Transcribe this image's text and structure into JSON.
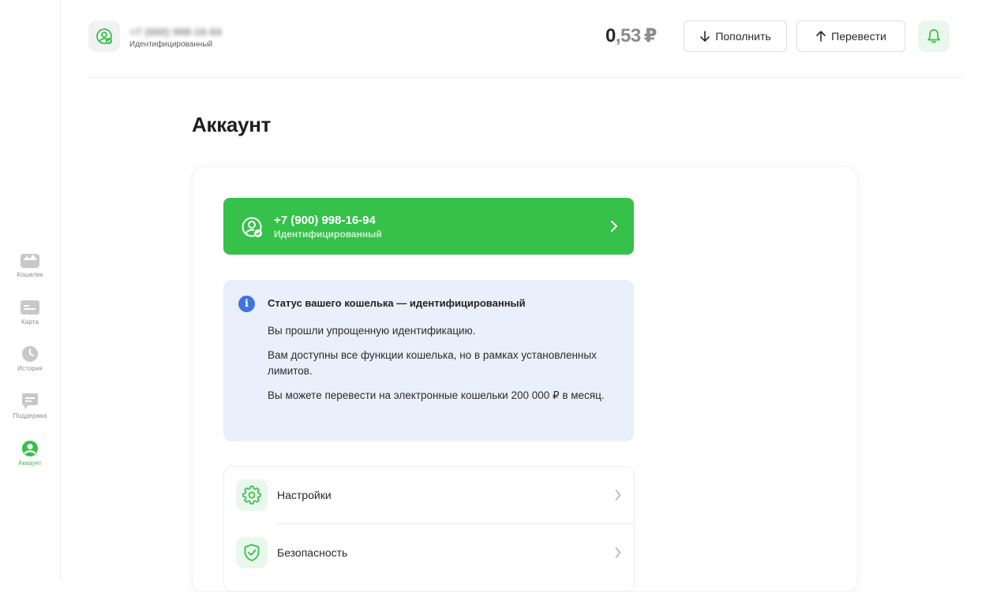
{
  "sidebar": {
    "items": [
      {
        "label": "Кошелек",
        "icon": "wallet-icon",
        "active": false
      },
      {
        "label": "Карта",
        "icon": "card-icon",
        "active": false
      },
      {
        "label": "История",
        "icon": "clock-icon",
        "active": false
      },
      {
        "label": "Поддержка",
        "icon": "chat-icon",
        "active": false
      },
      {
        "label": "Аккаунт",
        "icon": "user-icon",
        "active": true
      }
    ]
  },
  "header": {
    "user_phone": "+7 (900) 998-16-94",
    "user_status": "Идентифицированный",
    "balance_int": "0",
    "balance_dec": ",53",
    "balance_currency": "₽",
    "topup_label": "Пополнить",
    "transfer_label": "Перевести"
  },
  "page": {
    "title": "Аккаунт"
  },
  "account_banner": {
    "phone": "+7 (900) 998-16-94",
    "status": "Идентифицированный"
  },
  "info": {
    "title": "Статус вашего кошелька — идентифицированный",
    "p1": "Вы прошли упрощенную идентификацию.",
    "p2": "Вам доступны все функции кошелька, но в рамках установленных лимитов.",
    "p3": "Вы можете перевести на электронные кошельки 200 000 ₽ в месяц."
  },
  "menu": {
    "items": [
      {
        "label": "Настройки",
        "icon": "gear-icon"
      },
      {
        "label": "Безопасность",
        "icon": "shield-check-icon"
      }
    ]
  },
  "colors": {
    "accent": "#35c14a",
    "info_bg": "#e9f0fc",
    "info_icon": "#3f73e0",
    "icon_bg": "#eaf7ec"
  }
}
